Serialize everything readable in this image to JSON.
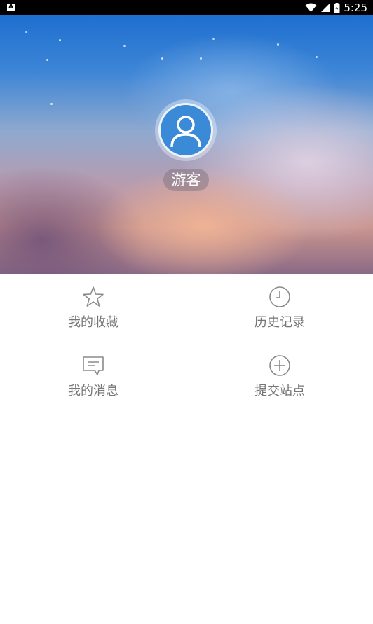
{
  "status_bar": {
    "time": "5:25",
    "notification_icon": "A"
  },
  "profile": {
    "username": "游客",
    "avatar_icon": "user-icon"
  },
  "menu": {
    "items": [
      {
        "label": "我的收藏",
        "icon": "star-icon"
      },
      {
        "label": "历史记录",
        "icon": "clock-icon"
      },
      {
        "label": "我的消息",
        "icon": "message-icon"
      },
      {
        "label": "提交站点",
        "icon": "plus-circle-icon"
      }
    ]
  },
  "colors": {
    "avatar_bg": "#3a8ad8",
    "menu_text": "#757575",
    "divider": "#d8d8d8"
  }
}
